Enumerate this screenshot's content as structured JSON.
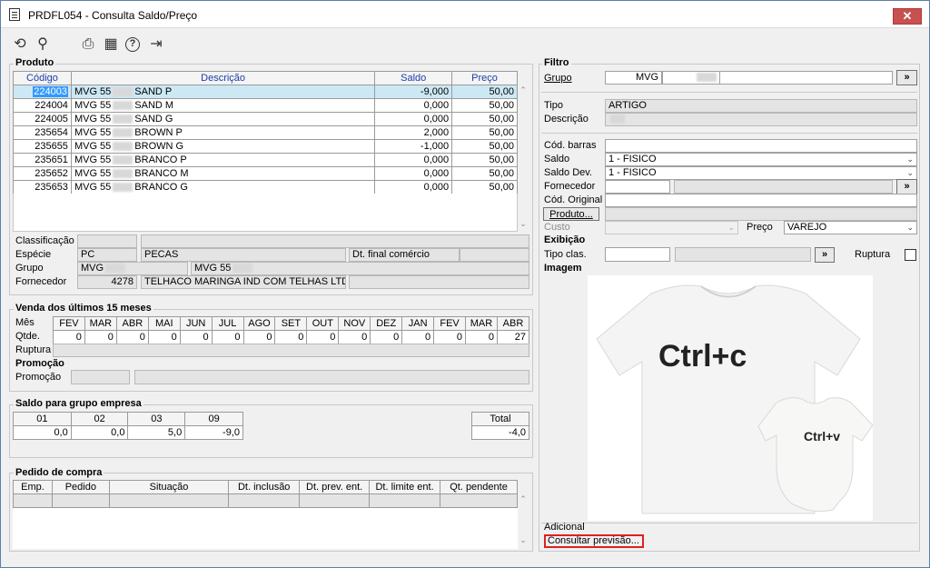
{
  "window": {
    "title": "PRDFL054 - Consulta Saldo/Preço",
    "close": "✕"
  },
  "toolbar": [
    {
      "name": "refresh-icon",
      "glyph": "⟲"
    },
    {
      "name": "search-icon",
      "glyph": "⚲"
    },
    {
      "name": "print-icon",
      "glyph": "⎙"
    },
    {
      "name": "calendar-icon",
      "glyph": "▦"
    },
    {
      "name": "help-icon",
      "glyph": "?"
    },
    {
      "name": "exit-icon",
      "glyph": "⇥"
    }
  ],
  "produto": {
    "section": "Produto",
    "columns": [
      "Código",
      "Descrição",
      "Saldo",
      "Preço"
    ],
    "rows": [
      {
        "codigo": "224003",
        "desc_a": "MVG 55",
        "desc_b": "SAND P",
        "saldo": "-9,000",
        "preco": "50,00"
      },
      {
        "codigo": "224004",
        "desc_a": "MVG 55",
        "desc_b": "SAND M",
        "saldo": "0,000",
        "preco": "50,00"
      },
      {
        "codigo": "224005",
        "desc_a": "MVG 55",
        "desc_b": "SAND G",
        "saldo": "0,000",
        "preco": "50,00"
      },
      {
        "codigo": "235654",
        "desc_a": "MVG 55",
        "desc_b": "BROWN P",
        "saldo": "2,000",
        "preco": "50,00"
      },
      {
        "codigo": "235655",
        "desc_a": "MVG 55",
        "desc_b": "BROWN G",
        "saldo": "-1,000",
        "preco": "50,00"
      },
      {
        "codigo": "235651",
        "desc_a": "MVG 55",
        "desc_b": "BRANCO P",
        "saldo": "0,000",
        "preco": "50,00"
      },
      {
        "codigo": "235652",
        "desc_a": "MVG 55",
        "desc_b": "BRANCO M",
        "saldo": "0,000",
        "preco": "50,00"
      },
      {
        "codigo": "235653",
        "desc_a": "MVG 55",
        "desc_b": "BRANCO G",
        "saldo": "0,000",
        "preco": "50,00"
      }
    ],
    "classificacao_label": "Classificação",
    "especie_label": "Espécie",
    "especie_code": "PC",
    "especie_desc": "PECAS",
    "dt_final_label": "Dt. final comércio",
    "grupo_label": "Grupo",
    "grupo_code": "MVG",
    "grupo_desc": "MVG 55",
    "fornecedor_label": "Fornecedor",
    "fornecedor_code": "4278",
    "fornecedor_name": "TELHACO MARINGA IND COM TELHAS LTDA"
  },
  "vendas": {
    "section": "Venda dos últimos 15 meses",
    "mes_label": "Mês",
    "qtde_label": "Qtde.",
    "ruptura_label": "Ruptura",
    "months": [
      "FEV",
      "MAR",
      "ABR",
      "MAI",
      "JUN",
      "JUL",
      "AGO",
      "SET",
      "OUT",
      "NOV",
      "DEZ",
      "JAN",
      "FEV",
      "MAR",
      "ABR"
    ],
    "qty": [
      "0",
      "0",
      "0",
      "0",
      "0",
      "0",
      "0",
      "0",
      "0",
      "0",
      "0",
      "0",
      "0",
      "0",
      "27"
    ]
  },
  "promocao": {
    "section": "Promoção",
    "label": "Promoção"
  },
  "saldo_grupo": {
    "section": "Saldo para grupo empresa",
    "columns": [
      "01",
      "02",
      "03",
      "09"
    ],
    "values": [
      "0,0",
      "0,0",
      "5,0",
      "-9,0"
    ],
    "total_label": "Total",
    "total": "-4,0"
  },
  "pedido": {
    "section": "Pedido de compra",
    "columns": [
      "Emp.",
      "Pedido",
      "Situação",
      "Dt. inclusão",
      "Dt. prev. ent.",
      "Dt. limite ent.",
      "Qt. pendente"
    ]
  },
  "filtro": {
    "section": "Filtro",
    "grupo_label": "Grupo",
    "grupo_value": "MVG",
    "lookup": "»",
    "tipo_label": "Tipo",
    "tipo_value": "ARTIGO",
    "descricao_label": "Descrição",
    "cod_barras_label": "Cód. barras",
    "saldo_label": "Saldo",
    "saldo_value": "1 - FISICO",
    "saldo_dev_label": "Saldo Dev.",
    "saldo_dev_value": "1 - FISICO",
    "fornecedor_label": "Fornecedor",
    "cod_original_label": "Cód. Original",
    "produto_btn": "Produto...",
    "custo_label": "Custo",
    "preco_label": "Preço",
    "preco_value": "VAREJO"
  },
  "exibicao": {
    "section": "Exibição",
    "tipo_clas_label": "Tipo clas.",
    "ruptura_label": "Ruptura"
  },
  "imagem": {
    "section": "Imagem",
    "text_big": "Ctrl+c",
    "text_small": "Ctrl+v"
  },
  "adicional": {
    "label": "Adicional",
    "link": "Consultar previsão..."
  }
}
